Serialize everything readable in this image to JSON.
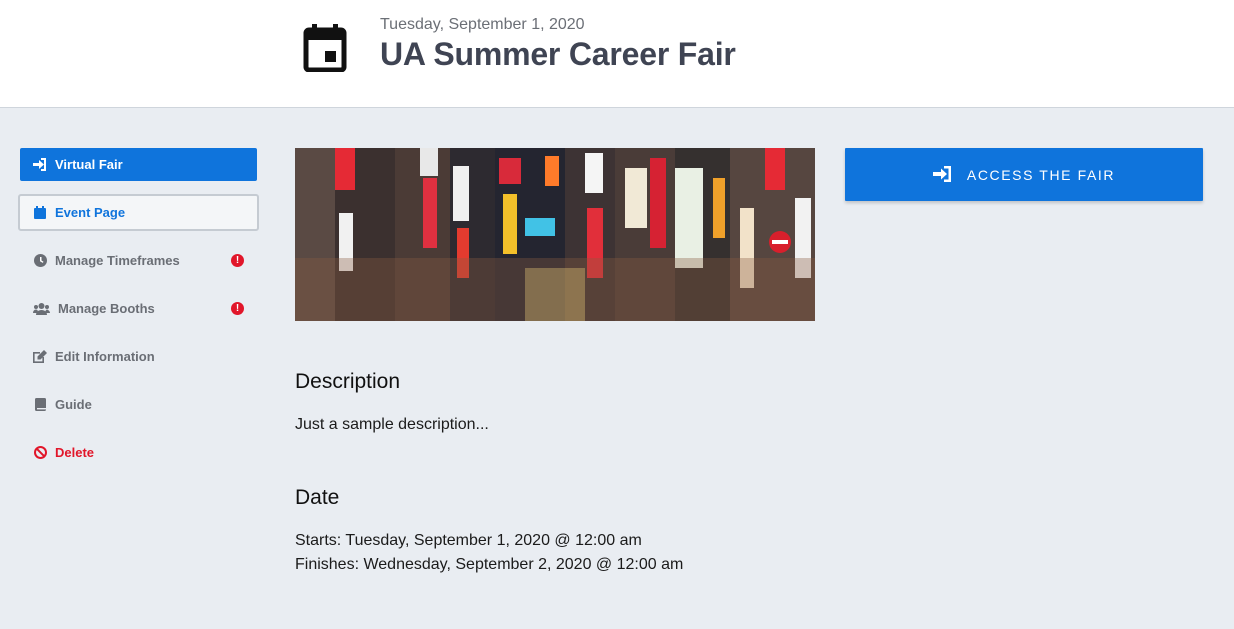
{
  "header": {
    "icon": "calendar-icon",
    "date": "Tuesday, September 1, 2020",
    "title": "UA Summer Career Fair"
  },
  "sidebar": {
    "items": [
      {
        "label": "Virtual Fair",
        "icon": "sign-in-icon",
        "state": "active"
      },
      {
        "label": "Event Page",
        "icon": "calendar-icon",
        "state": "current"
      },
      {
        "label": "Manage Timeframes",
        "icon": "clock-icon",
        "badge": "!"
      },
      {
        "label": "Manage Booths",
        "icon": "users-icon",
        "badge": "!"
      },
      {
        "label": "Edit Information",
        "icon": "edit-icon"
      },
      {
        "label": "Guide",
        "icon": "book-icon"
      },
      {
        "label": "Delete",
        "icon": "ban-icon",
        "state": "danger"
      }
    ]
  },
  "main": {
    "description_heading": "Description",
    "description_text": "Just a sample description...",
    "date_heading": "Date",
    "starts": "Starts: Tuesday, September 1, 2020 @ 12:00 am",
    "finishes": "Finishes: Wednesday, September 2, 2020 @ 12:00 am"
  },
  "access": {
    "label": "ACCESS THE FAIR",
    "icon": "sign-in-icon"
  },
  "colors": {
    "primary": "#0f74dc",
    "danger": "#e1162a",
    "background": "#e9edf2",
    "title": "#3f4453"
  }
}
